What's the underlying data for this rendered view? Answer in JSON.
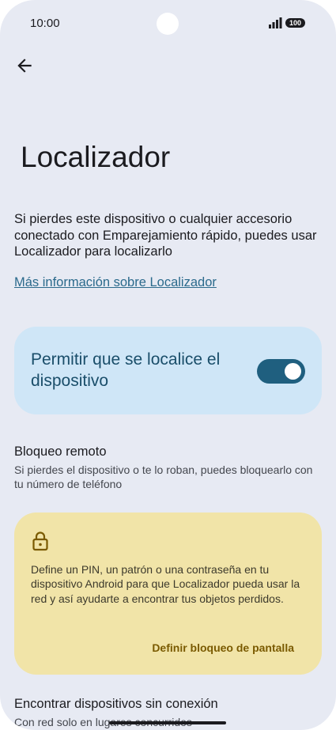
{
  "status": {
    "time": "10:00",
    "battery": "100"
  },
  "header": {
    "title": "Localizador"
  },
  "intro": {
    "description": "Si pierdes este dispositivo o cualquier accesorio conectado con Emparejamiento rápido, puedes usar Localizador para localizarlo",
    "link": "Más información sobre Localizador"
  },
  "toggle": {
    "label": "Permitir que se localice el dispositivo",
    "enabled": true
  },
  "remote_lock": {
    "title": "Bloqueo remoto",
    "description": "Si pierdes el dispositivo o te lo roban, puedes bloquearlo con tu número de teléfono"
  },
  "warning": {
    "icon": "lock-icon",
    "text": "Define un PIN, un patrón o una contraseña en tu dispositivo Android para que Localizador pueda usar la red y así ayudarte a encontrar tus objetos perdidos.",
    "action": "Definir bloqueo de pantalla"
  },
  "offline": {
    "title": "Encontrar dispositivos sin conexión",
    "description": "Con red solo en lugares concurridos"
  },
  "colors": {
    "background": "#e7eaf3",
    "toggle_card": "#cfe6f7",
    "switch_on": "#1f5f7f",
    "warning_card": "#f1e4a8",
    "link": "#2b6a8c"
  }
}
